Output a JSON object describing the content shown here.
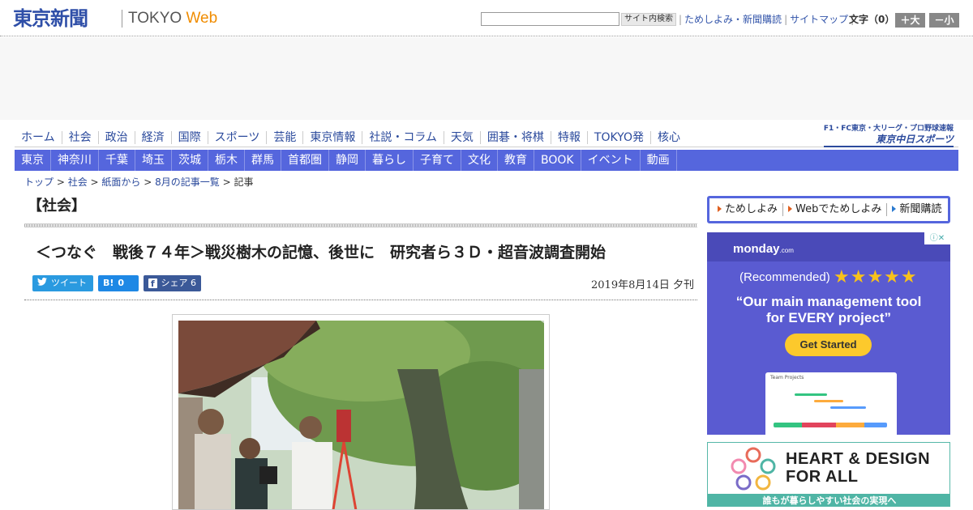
{
  "header": {
    "logo_ja": "東京新聞",
    "logo_en_main": "TOKYO",
    "logo_en_web": "Web",
    "search_button": "サイト内検索",
    "links": [
      "ためしよみ・新聞購読",
      "サイトマップ"
    ],
    "font_size_label": "文字（0）",
    "font_bigger": "＋大",
    "font_smaller": "－小"
  },
  "nav_primary": [
    "ホーム",
    "社会",
    "政治",
    "経済",
    "国際",
    "スポーツ",
    "芸能",
    "東京情報",
    "社説・コラム",
    "天気",
    "囲碁・将棋",
    "特報",
    "TOKYO発",
    "核心"
  ],
  "chunichi": {
    "small": "F1・FC東京・大リーグ・プロ野球速報",
    "big": "東京中日スポーツ"
  },
  "nav_regions": [
    "東京",
    "神奈川",
    "千葉",
    "埼玉",
    "茨城",
    "栃木",
    "群馬",
    "首都圏",
    "静岡",
    "暮らし",
    "子育て",
    "文化",
    "教育",
    "BOOK",
    "イベント",
    "動画"
  ],
  "breadcrumb": {
    "items": [
      "トップ",
      "社会",
      "紙面から",
      "8月の記事一覧"
    ],
    "current": "記事",
    "separator": " > "
  },
  "article": {
    "section": "【社会】",
    "headline": "＜つなぐ　戦後７４年＞戦災樹木の記憶、後世に　研究者ら３Ｄ・超音波調査開始",
    "date": "2019年8月14日 夕刊",
    "share": {
      "tweet": "ツイート",
      "hatena_icon": "B!",
      "hatena_count": "0",
      "facebook_label": "シェア",
      "facebook_count": "6"
    }
  },
  "sidebar": {
    "links": [
      "ためしよみ",
      "Webでためしよみ",
      "新聞購読"
    ],
    "ad_monday": {
      "brand": "monday",
      "brand_suffix": ".com",
      "recommended": "(Recommended)",
      "quote_line1": "“Our main management tool",
      "quote_line2": "for EVERY project”",
      "cta": "Get Started",
      "screenshot_title": "Team Projects"
    },
    "ad_heart": {
      "title_line1": "HEART & DESIGN",
      "title_line2": "FOR ALL",
      "subtitle": "誰もが暮らしやすい社会の実現へ"
    }
  },
  "colors": {
    "brand_blue": "#2f4fa8",
    "nav_band": "#5566dd",
    "web_orange": "#f08c00",
    "twitter": "#2a9ae0",
    "hatena": "#1e88e5",
    "facebook": "#3b5998",
    "monday_bg": "#5a5bd1",
    "heart_teal": "#4fb5a5"
  }
}
